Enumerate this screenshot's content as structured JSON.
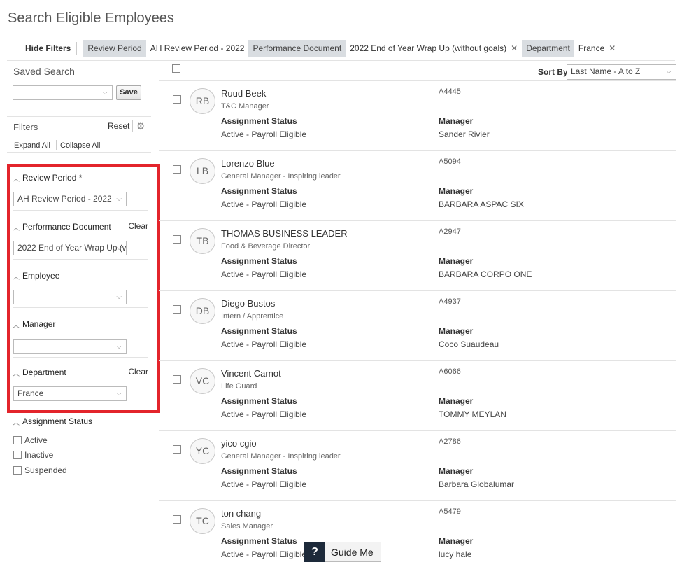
{
  "page": {
    "title": "Search Eligible Employees"
  },
  "filter_bar": {
    "hide_filters": "Hide Filters",
    "chips": [
      {
        "label": "Review Period",
        "value": "AH Review Period - 2022",
        "removable": false
      },
      {
        "label": "Performance Document",
        "value": "2022 End of Year Wrap Up (without goals)",
        "removable": true
      },
      {
        "label": "Department",
        "value": "France",
        "removable": true
      }
    ]
  },
  "saved_search": {
    "title": "Saved Search",
    "value": "",
    "save_label": "Save"
  },
  "filters": {
    "title": "Filters",
    "reset_label": "Reset",
    "expand_all": "Expand All",
    "collapse_all": "Collapse All",
    "sections": [
      {
        "title": "Review Period *",
        "value": "AH Review Period - 2022",
        "clear": ""
      },
      {
        "title": "Performance Document",
        "value": "2022 End of Year Wrap Up (w",
        "clear": "Clear"
      },
      {
        "title": "Employee",
        "value": "",
        "clear": ""
      },
      {
        "title": "Manager",
        "value": "",
        "clear": ""
      },
      {
        "title": "Department",
        "value": "France",
        "clear": "Clear"
      }
    ],
    "assignment_status": {
      "title": "Assignment Status",
      "options": [
        "Active",
        "Inactive",
        "Suspended"
      ]
    }
  },
  "results": {
    "sort_by_label": "Sort By",
    "sort_value": "Last Name - A to Z",
    "labels": {
      "assignment_status": "Assignment Status",
      "manager": "Manager"
    },
    "employees": [
      {
        "initials": "RB",
        "name": "Ruud Beek",
        "title": "T&C Manager",
        "id": "A4445",
        "status": "Active - Payroll Eligible",
        "manager": "Sander Rivier"
      },
      {
        "initials": "LB",
        "name": "Lorenzo Blue",
        "title": "General Manager - Inspiring leader",
        "id": "A5094",
        "status": "Active - Payroll Eligible",
        "manager": "BARBARA ASPAC SIX"
      },
      {
        "initials": "TB",
        "name": "THOMAS BUSINESS LEADER",
        "title": "Food & Beverage Director",
        "id": "A2947",
        "status": "Active - Payroll Eligible",
        "manager": "BARBARA CORPO ONE"
      },
      {
        "initials": "DB",
        "name": "Diego Bustos",
        "title": "Intern / Apprentice",
        "id": "A4937",
        "status": "Active - Payroll Eligible",
        "manager": "Coco Suaudeau"
      },
      {
        "initials": "VC",
        "name": "Vincent Carnot",
        "title": "Life Guard",
        "id": "A6066",
        "status": "Active - Payroll Eligible",
        "manager": "TOMMY MEYLAN"
      },
      {
        "initials": "YC",
        "name": "yico cgio",
        "title": "General Manager - Inspiring leader",
        "id": "A2786",
        "status": "Active - Payroll Eligible",
        "manager": "Barbara Globalumar"
      },
      {
        "initials": "TC",
        "name": "ton chang",
        "title": "Sales Manager",
        "id": "A5479",
        "status": "Active - Payroll Eligible",
        "manager": "lucy hale"
      }
    ]
  },
  "guide_me": {
    "icon": "?",
    "label": "Guide Me"
  },
  "colors": {
    "highlight": "#e3242b",
    "chip_bg": "#d9dde1",
    "guide_icon_bg": "#1d2a3a"
  }
}
